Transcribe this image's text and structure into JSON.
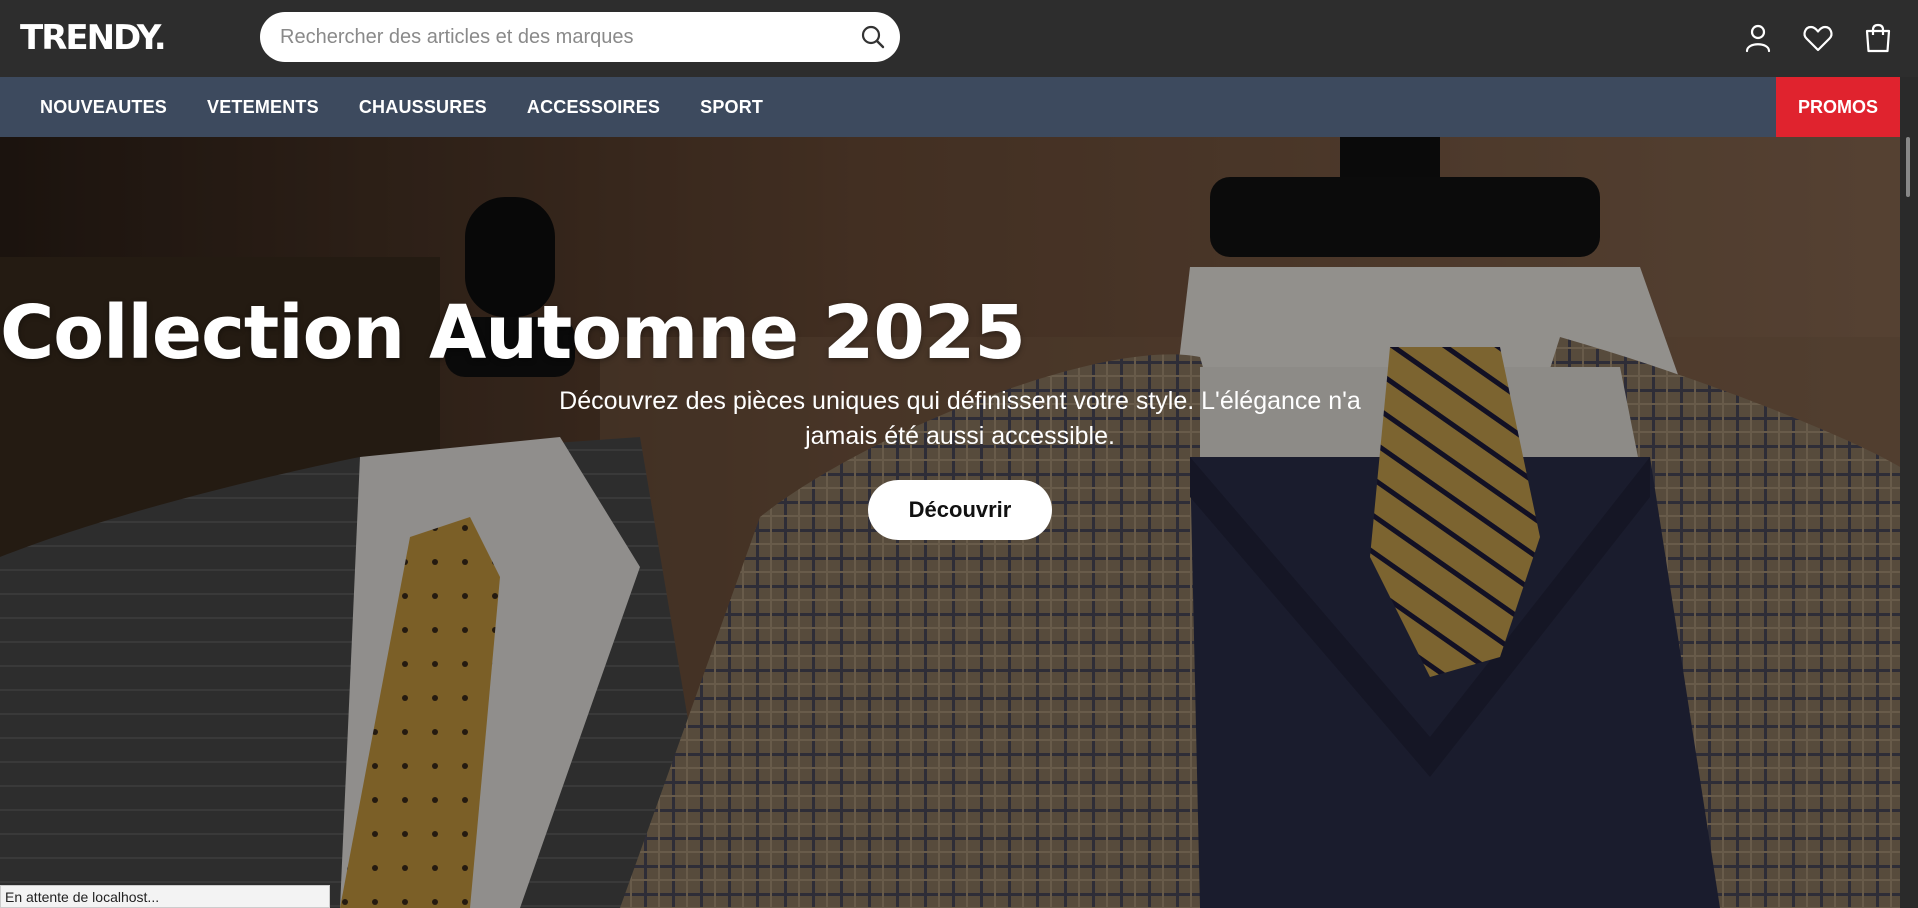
{
  "header": {
    "logo": "TRENDY.",
    "search": {
      "placeholder": "Rechercher des articles et des marques",
      "value": ""
    },
    "icons": [
      "search-icon",
      "user-icon",
      "heart-icon",
      "shopping-bag-icon"
    ]
  },
  "nav": {
    "items": [
      {
        "label": "NOUVEAUTES"
      },
      {
        "label": "VETEMENTS"
      },
      {
        "label": "CHAUSSURES"
      },
      {
        "label": "ACCESSOIRES"
      },
      {
        "label": "SPORT"
      }
    ],
    "promo_label": "PROMOS"
  },
  "hero": {
    "title": "Collection Automne 2025",
    "subtitle": "Découvrez des pièces uniques qui définissent votre style. L'élégance n'a jamais été aussi accessible.",
    "cta_label": "Découvrir"
  },
  "status": {
    "text": "En attente de localhost..."
  },
  "colors": {
    "topbar": "#2d2d2d",
    "nav": "#3d4a5e",
    "promo": "#e0232e",
    "hero_text": "#ffffff"
  }
}
